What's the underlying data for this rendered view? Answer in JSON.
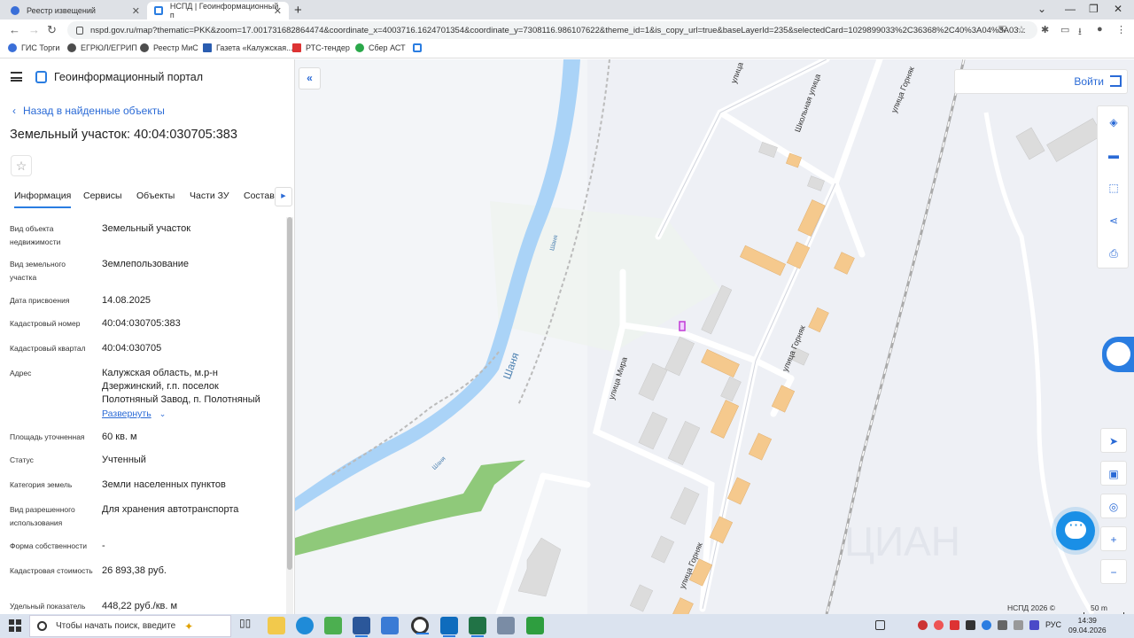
{
  "browser": {
    "tabs": [
      {
        "title": "Реестр извещений"
      },
      {
        "title": "НСПД | Геоинформационный п"
      }
    ],
    "url": "nspd.gov.ru/map?thematic=PKK&zoom=17.001731682864474&coordinate_x=4003716.1624701354&coordinate_y=7308116.986107622&theme_id=1&is_copy_url=true&baseLayerId=235&selectedCard=1029899033%2C36368%2C40%3A04%3A03...",
    "bookmarks": [
      {
        "label": "ГИС Торги",
        "color": "#3a6fd8"
      },
      {
        "label": "ЕГРЮЛ/ЕГРИП",
        "color": "#4d4d4d"
      },
      {
        "label": "Реестр МиС",
        "color": "#4d4d4d"
      },
      {
        "label": "Газета «Калужская...",
        "color": "#2a5db0"
      },
      {
        "label": "РТС-тендер",
        "color": "#d33"
      },
      {
        "label": "Сбер АСТ",
        "color": "#2aa84a"
      }
    ]
  },
  "portal": {
    "title": "Геоинформационный портал",
    "back_link": "Назад в найденные объекты",
    "page_title": "Земельный участок: 40:04:030705:383",
    "tabs": [
      "Информация",
      "Сервисы",
      "Объекты",
      "Части ЗУ",
      "Состав"
    ],
    "properties": [
      {
        "label": "Вид объекта недвижимости",
        "value": "Земельный участок"
      },
      {
        "label": "Вид земельного участка",
        "value": "Землепользование"
      },
      {
        "label": "Дата присвоения",
        "value": "14.08.2025"
      },
      {
        "label": "Кадастровый номер",
        "value": "40:04:030705:383"
      },
      {
        "label": "Кадастровый квартал",
        "value": "40:04:030705"
      },
      {
        "label": "Адрес",
        "value": "Калужская область, м.р-н Дзержинский, г.п. поселок Полотняный Завод, п. Полотняный"
      },
      {
        "label": "Площадь уточненная",
        "value": "60 кв. м"
      },
      {
        "label": "Статус",
        "value": "Учтенный"
      },
      {
        "label": "Категория земель",
        "value": "Земли населенных пунктов"
      },
      {
        "label": "Вид разрешенного использования",
        "value": "Для хранения автотранспорта"
      },
      {
        "label": "Форма собственности",
        "value": "-"
      },
      {
        "label": "Кадастровая стоимость",
        "value": "26 893,38 руб."
      },
      {
        "label": "Удельный показатель",
        "value": "448,22 руб./кв. м"
      }
    ],
    "expand_label": "Развернуть"
  },
  "map": {
    "login_label": "Войти",
    "footer": "НСПД 2026 ©",
    "scale": "50 m",
    "labels": {
      "river": "Шаня",
      "river_small_1": "Шаня",
      "river_small_2": "Шаня",
      "street_mira": "улица Мира",
      "street_gornyak_1": "улица Горняк",
      "street_gornyak_2": "улица Горняк",
      "street_gornyak_3": "улица Горняк",
      "street_shkolnaya": "Школьная улица",
      "street_top": "улица"
    },
    "watermark": "ЦИАН",
    "colors": {
      "water": "#aad3f7",
      "building_orange": "#f5c98d",
      "building_grey": "#dcdcdc",
      "green": "#8fc97a",
      "parcel": "#c13bd6"
    }
  },
  "taskbar": {
    "search_placeholder": "Чтобы начать поиск, введите",
    "lang": "РУС",
    "time": "14:39",
    "date": "09.04.2026"
  }
}
